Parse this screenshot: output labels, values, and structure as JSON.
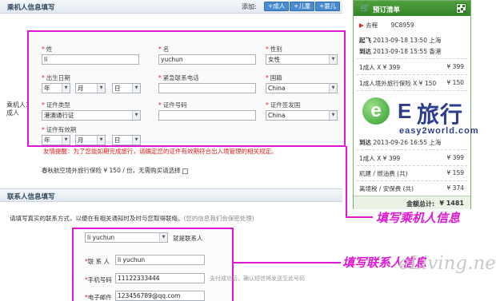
{
  "passenger": {
    "section_title": "乘机人信息填写",
    "add_label": "添加:",
    "add_buttons": [
      "+成人",
      "+儿童",
      "+婴儿"
    ],
    "row_label_1": "乘机人1",
    "row_label_2": "成人",
    "fields": {
      "surname_label": "姓",
      "surname_value": "li",
      "given_label": "名",
      "given_value": "yuchun",
      "gender_label": "性别",
      "gender_value": "女性",
      "birth_label": "出生日期",
      "birth_year": "年",
      "birth_month": "月",
      "birth_day": "日",
      "emergency_label": "紧急联系电话",
      "nationality_label": "国籍",
      "nationality_value": "China",
      "id_type_label": "证件类型",
      "id_type_value": "港澳通行证",
      "id_number_label": "证件号码",
      "issuing_label": "证件签发国",
      "issuing_value": "China",
      "expiry_label": "证件有效期",
      "expiry_year": "年",
      "expiry_month": "月",
      "expiry_day": "日"
    },
    "warning": "友情提醒：为了您能如期完成旅行，请确定您的证件有效期符合出入境管理的相关规定。",
    "insurance_text": "春秋航空境外旅行保险 ¥ 150 / 份，无需购买请选择"
  },
  "contact": {
    "section_title": "联系人信息填写",
    "tip": "请填写真实的联系方式，以便在有相关通知时及时与您取得联络。",
    "tip_grey": "(您的信息我们会保密处理)",
    "select_value": "li yuchun",
    "is_contact": "就是联系人",
    "name_label": "联 系 人",
    "name_value": "li yuchun",
    "phone_label": "手机号码",
    "phone_value": "11122333444",
    "email_label": "电子邮件",
    "email_value": "123456789@qq.com",
    "side_note": "支付成功后，确认短信将发送至此号码"
  },
  "order": {
    "title": "预订清单",
    "outbound_label": "去程",
    "flight_no": "9C8959",
    "depart_label": "起飞",
    "depart_time": "2013-09-18 13:50",
    "depart_city": "上海",
    "arrive_label": "到达",
    "arrive_time": "2013-09-18 15:55",
    "arrive_city": "香港",
    "adult_line": "1成人 X ¥ 399",
    "adult_price": "¥ 399",
    "ins_line": "1成人境外旅行保险 X ¥ 150",
    "ins_price": "¥ 150",
    "return_arrive_time": "2013-09-26 16:55",
    "return_arrive_city": "上海",
    "return_adult_line": "1成人 X ¥ 399",
    "return_adult_price": "¥ 399",
    "fuel_line": "机建 / 燃油费 (共)",
    "fuel_price": "¥ 159",
    "tax_line": "离境税 / 安保费 (共)",
    "tax_price": "¥ 374",
    "total_label": "金额总计:",
    "total_value": "¥ 1481"
  },
  "annotations": {
    "passenger_note": "填写乘机人信息",
    "contact_note": "填写联系人信息",
    "watermark": "eLiving.net",
    "logo_cn": "旅行",
    "logo_letter": "E",
    "logo_sub": "easy2world.com"
  },
  "colors": {
    "annotation": "#e016d6",
    "order_green": "#36842a",
    "required_red": "#e01a1a",
    "button_blue": "#4a8bd0"
  }
}
